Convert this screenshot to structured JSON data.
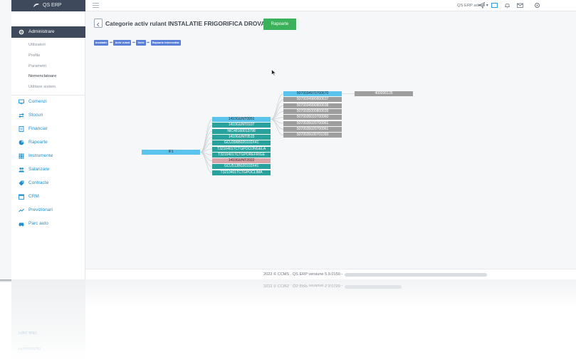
{
  "app": {
    "brand": "QS ERP",
    "accent": "#1e8fcf",
    "sidebar_dark": "#3e4a5b"
  },
  "topbar": {
    "user_label": "QS ERP admin ▾",
    "icons": [
      "hamburger-icon",
      "send-icon",
      "window-icon",
      "bell-icon",
      "mail-icon",
      "gear-icon"
    ]
  },
  "sidebar": {
    "section_title": "Administrare",
    "sub_items": [
      {
        "label": "Utilizatori",
        "active": false
      },
      {
        "label": "Profile",
        "active": false
      },
      {
        "label": "Parametri",
        "active": false
      },
      {
        "label": "Nomenclatoare",
        "active": true
      },
      {
        "label": "Utilitare sistem",
        "active": false
      }
    ],
    "items": [
      {
        "label": "Comenzi",
        "icon": "monitor-icon"
      },
      {
        "label": "Stocuri",
        "icon": "arrows-icon"
      },
      {
        "label": "Financiar",
        "icon": "document-icon"
      },
      {
        "label": "Rapoarte",
        "icon": "pie-icon"
      },
      {
        "label": "Instrumente",
        "icon": "grid-icon"
      },
      {
        "label": "Salarizare",
        "icon": "users-icon"
      },
      {
        "label": "Contracte",
        "icon": "tag-icon"
      },
      {
        "label": "CRM",
        "icon": "calendar-icon"
      },
      {
        "label": "Previzionari",
        "icon": "trend-icon"
      },
      {
        "label": "Parc auto",
        "icon": "car-icon"
      }
    ]
  },
  "main": {
    "title": "Categorie activ rulant INSTALATIE FRIGORIFICA DROVARES",
    "report_button": "Rapoarte",
    "breadcrumb": [
      "Instalatie",
      "Activ rulant",
      "Serie",
      "Rapoarte intermediar"
    ]
  },
  "tree": {
    "root": {
      "label": "IF1",
      "style": "cyan"
    },
    "level1": [
      {
        "label": "1410GUNT0951",
        "style": "cyan"
      },
      {
        "label": "1410GUNT0107",
        "style": "teal"
      },
      {
        "label": "NIC48160013798",
        "style": "teal"
      },
      {
        "label": "1410GUNT0515",
        "style": "teal"
      },
      {
        "label": "GCU306B020102X41",
        "style": "teal"
      },
      {
        "label": "T3210401TCTGPOCONGELA",
        "style": "teal"
      },
      {
        "label": "T3210401TCTGPOREFRIGE",
        "style": "teal"
      },
      {
        "label": "1410GUNT2022",
        "style": "pink"
      },
      {
        "label": "GCU513B020102X41",
        "style": "teal"
      },
      {
        "label": "T3210401TCTGPOCLIMA",
        "style": "teal"
      }
    ],
    "level2": [
      {
        "label": "5070034970700670",
        "style": "cyan"
      },
      {
        "label": "5070034980800637",
        "style": "gray"
      },
      {
        "label": "5070034990800638",
        "style": "gray"
      },
      {
        "label": "5070035000800639",
        "style": "gray"
      },
      {
        "label": "5070035010700960",
        "style": "gray"
      },
      {
        "label": "5070035020700961",
        "style": "gray"
      },
      {
        "label": "5070035020700961",
        "style": "gray"
      },
      {
        "label": "5070035030701093",
        "style": "gray"
      }
    ],
    "level3": [
      {
        "label": "400000126",
        "style": "gray"
      }
    ]
  },
  "footer": {
    "text": "2022 © CCMS . QS ERP versiune 5.9.0150 -"
  },
  "reflection": {
    "footer_text": "2022 © CCMS . QS ERP versiune 5.9.0150 -",
    "items": [
      "Parc auto",
      "Previzionari"
    ]
  }
}
